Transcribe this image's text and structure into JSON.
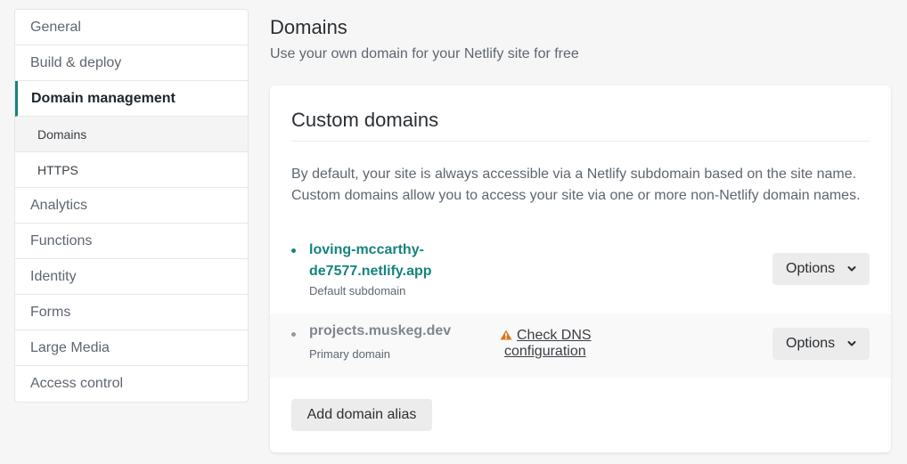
{
  "sidebar": {
    "items": [
      {
        "label": "General"
      },
      {
        "label": "Build & deploy"
      },
      {
        "label": "Domain management"
      },
      {
        "label": "Domains"
      },
      {
        "label": "HTTPS"
      },
      {
        "label": "Analytics"
      },
      {
        "label": "Functions"
      },
      {
        "label": "Identity"
      },
      {
        "label": "Forms"
      },
      {
        "label": "Large Media"
      },
      {
        "label": "Access control"
      }
    ]
  },
  "main": {
    "title": "Domains",
    "subtitle": "Use your own domain for your Netlify site for free",
    "card": {
      "title": "Custom domains",
      "description_line1": "By default, your site is always accessible via a Netlify subdomain based on the site name.",
      "description_line2": "Custom domains allow you to access your site via one or more non-Netlify domain names.",
      "domains": [
        {
          "name_line1": "loving-mccarthy-",
          "name_line2": "de7577.netlify.app",
          "caption": "Default subdomain",
          "options_label": "Options"
        },
        {
          "name": "projects.muskeg.dev",
          "caption": "Primary domain",
          "dns_check_line1": "Check DNS",
          "dns_check_line2": "configuration",
          "options_label": "Options"
        }
      ],
      "add_alias_label": "Add domain alias"
    }
  },
  "colors": {
    "accent": "#15847d",
    "warning": "#d27a1d"
  },
  "icons": {
    "warning": "warning-triangle-icon",
    "chevron": "chevron-down-icon"
  }
}
